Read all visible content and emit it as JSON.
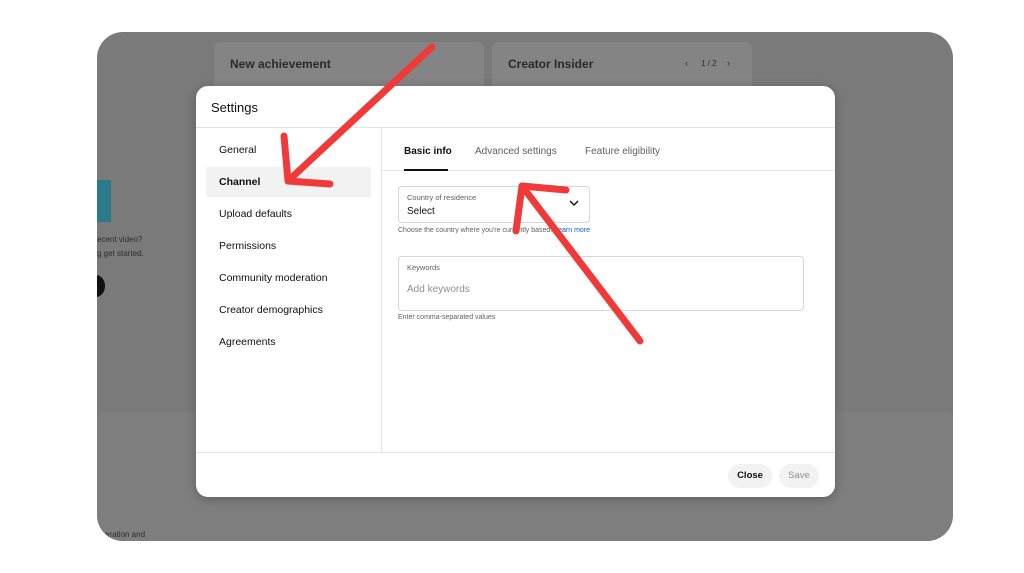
{
  "background": {
    "card_left_title": "New achievement",
    "card_right_title": "Creator Insider",
    "pager": "1 / 2",
    "side_text_1": "ecent video?",
    "side_text_2": "g get started.",
    "bottom_text": "eration and"
  },
  "modal": {
    "title": "Settings",
    "nav": [
      {
        "label": "General"
      },
      {
        "label": "Channel"
      },
      {
        "label": "Upload defaults"
      },
      {
        "label": "Permissions"
      },
      {
        "label": "Community moderation"
      },
      {
        "label": "Creator demographics"
      },
      {
        "label": "Agreements"
      }
    ],
    "active_nav": "Channel",
    "tabs": [
      {
        "label": "Basic info"
      },
      {
        "label": "Advanced settings"
      },
      {
        "label": "Feature eligibility"
      }
    ],
    "country": {
      "label": "Country of residence",
      "value": "Select",
      "helper": "Choose the country where you're currently based.",
      "helper_link": "Learn more"
    },
    "keywords": {
      "label": "Keywords",
      "placeholder": "Add keywords",
      "helper": "Enter comma-separated values"
    },
    "close_label": "Close",
    "save_label": "Save"
  },
  "colors": {
    "arrow": "#f03a3a",
    "link": "#065fd4"
  }
}
